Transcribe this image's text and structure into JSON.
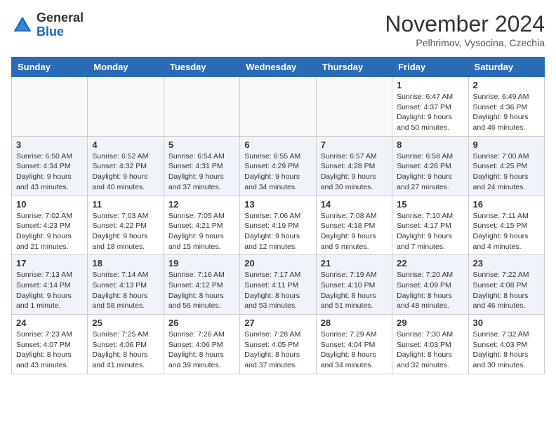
{
  "header": {
    "logo_line1": "General",
    "logo_line2": "Blue",
    "month_title": "November 2024",
    "location": "Pelhrimov, Vysocina, Czechia"
  },
  "columns": [
    "Sunday",
    "Monday",
    "Tuesday",
    "Wednesday",
    "Thursday",
    "Friday",
    "Saturday"
  ],
  "weeks": [
    [
      {
        "day": "",
        "info": ""
      },
      {
        "day": "",
        "info": ""
      },
      {
        "day": "",
        "info": ""
      },
      {
        "day": "",
        "info": ""
      },
      {
        "day": "",
        "info": ""
      },
      {
        "day": "1",
        "info": "Sunrise: 6:47 AM\nSunset: 4:37 PM\nDaylight: 9 hours\nand 50 minutes."
      },
      {
        "day": "2",
        "info": "Sunrise: 6:49 AM\nSunset: 4:36 PM\nDaylight: 9 hours\nand 46 minutes."
      }
    ],
    [
      {
        "day": "3",
        "info": "Sunrise: 6:50 AM\nSunset: 4:34 PM\nDaylight: 9 hours\nand 43 minutes."
      },
      {
        "day": "4",
        "info": "Sunrise: 6:52 AM\nSunset: 4:32 PM\nDaylight: 9 hours\nand 40 minutes."
      },
      {
        "day": "5",
        "info": "Sunrise: 6:54 AM\nSunset: 4:31 PM\nDaylight: 9 hours\nand 37 minutes."
      },
      {
        "day": "6",
        "info": "Sunrise: 6:55 AM\nSunset: 4:29 PM\nDaylight: 9 hours\nand 34 minutes."
      },
      {
        "day": "7",
        "info": "Sunrise: 6:57 AM\nSunset: 4:28 PM\nDaylight: 9 hours\nand 30 minutes."
      },
      {
        "day": "8",
        "info": "Sunrise: 6:58 AM\nSunset: 4:26 PM\nDaylight: 9 hours\nand 27 minutes."
      },
      {
        "day": "9",
        "info": "Sunrise: 7:00 AM\nSunset: 4:25 PM\nDaylight: 9 hours\nand 24 minutes."
      }
    ],
    [
      {
        "day": "10",
        "info": "Sunrise: 7:02 AM\nSunset: 4:23 PM\nDaylight: 9 hours\nand 21 minutes."
      },
      {
        "day": "11",
        "info": "Sunrise: 7:03 AM\nSunset: 4:22 PM\nDaylight: 9 hours\nand 18 minutes."
      },
      {
        "day": "12",
        "info": "Sunrise: 7:05 AM\nSunset: 4:21 PM\nDaylight: 9 hours\nand 15 minutes."
      },
      {
        "day": "13",
        "info": "Sunrise: 7:06 AM\nSunset: 4:19 PM\nDaylight: 9 hours\nand 12 minutes."
      },
      {
        "day": "14",
        "info": "Sunrise: 7:08 AM\nSunset: 4:18 PM\nDaylight: 9 hours\nand 9 minutes."
      },
      {
        "day": "15",
        "info": "Sunrise: 7:10 AM\nSunset: 4:17 PM\nDaylight: 9 hours\nand 7 minutes."
      },
      {
        "day": "16",
        "info": "Sunrise: 7:11 AM\nSunset: 4:15 PM\nDaylight: 9 hours\nand 4 minutes."
      }
    ],
    [
      {
        "day": "17",
        "info": "Sunrise: 7:13 AM\nSunset: 4:14 PM\nDaylight: 9 hours\nand 1 minute."
      },
      {
        "day": "18",
        "info": "Sunrise: 7:14 AM\nSunset: 4:13 PM\nDaylight: 8 hours\nand 58 minutes."
      },
      {
        "day": "19",
        "info": "Sunrise: 7:16 AM\nSunset: 4:12 PM\nDaylight: 8 hours\nand 56 minutes."
      },
      {
        "day": "20",
        "info": "Sunrise: 7:17 AM\nSunset: 4:11 PM\nDaylight: 8 hours\nand 53 minutes."
      },
      {
        "day": "21",
        "info": "Sunrise: 7:19 AM\nSunset: 4:10 PM\nDaylight: 8 hours\nand 51 minutes."
      },
      {
        "day": "22",
        "info": "Sunrise: 7:20 AM\nSunset: 4:09 PM\nDaylight: 8 hours\nand 48 minutes."
      },
      {
        "day": "23",
        "info": "Sunrise: 7:22 AM\nSunset: 4:08 PM\nDaylight: 8 hours\nand 46 minutes."
      }
    ],
    [
      {
        "day": "24",
        "info": "Sunrise: 7:23 AM\nSunset: 4:07 PM\nDaylight: 8 hours\nand 43 minutes."
      },
      {
        "day": "25",
        "info": "Sunrise: 7:25 AM\nSunset: 4:06 PM\nDaylight: 8 hours\nand 41 minutes."
      },
      {
        "day": "26",
        "info": "Sunrise: 7:26 AM\nSunset: 4:06 PM\nDaylight: 8 hours\nand 39 minutes."
      },
      {
        "day": "27",
        "info": "Sunrise: 7:28 AM\nSunset: 4:05 PM\nDaylight: 8 hours\nand 37 minutes."
      },
      {
        "day": "28",
        "info": "Sunrise: 7:29 AM\nSunset: 4:04 PM\nDaylight: 8 hours\nand 34 minutes."
      },
      {
        "day": "29",
        "info": "Sunrise: 7:30 AM\nSunset: 4:03 PM\nDaylight: 8 hours\nand 32 minutes."
      },
      {
        "day": "30",
        "info": "Sunrise: 7:32 AM\nSunset: 4:03 PM\nDaylight: 8 hours\nand 30 minutes."
      }
    ]
  ]
}
